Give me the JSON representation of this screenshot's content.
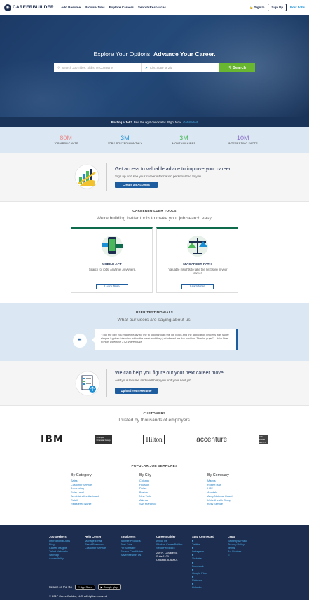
{
  "header": {
    "logo_text": "CAREERBUILDER",
    "nav": [
      "Add Resume",
      "Browse Jobs",
      "Explore Careers",
      "Search Resources"
    ],
    "sign_in": "Sign In",
    "sign_up": "Sign Up",
    "post_jobs": "Post Jobs"
  },
  "hero": {
    "title_a": "Explore Your Options.",
    "title_b": "Advance Your Career.",
    "keywords_placeholder": "Search Job Titles, Skills, or Company",
    "location_placeholder": "City, State or Zip",
    "search_button": "Search"
  },
  "post_bar": {
    "lead": "Posting a Job?",
    "text": "Find the right candidates. Right Now.",
    "link": "Get started"
  },
  "stats": [
    {
      "value": "80M",
      "label": "JOB APPLICANTS",
      "color": "#e98b8b"
    },
    {
      "value": "3M",
      "label": "JOBS POSTED MONTHLY",
      "color": "#1b8fd6"
    },
    {
      "value": "3M",
      "label": "MONTHLY HIRES",
      "color": "#4cb85c"
    },
    {
      "value": "10M",
      "label": "INTERESTING FACTS",
      "color": "#8a6ec9"
    }
  ],
  "access": {
    "title": "Get access to valuable advice to improve your career.",
    "subtitle": "Sign up and see your career information personalized to you.",
    "button": "Create an Account"
  },
  "tools": {
    "kicker": "CAREERBUILDER TOOLS",
    "subtitle": "We're building better tools to make your job search easy.",
    "cards": [
      {
        "title": "MOBILE APP",
        "text": "Search for jobs. Anytime. Anywhere.",
        "button": "Learn More"
      },
      {
        "title": "MY CAREER PATH",
        "text": "Valuable insights to take the next step in your career.",
        "button": "Learn More"
      }
    ]
  },
  "testimonials": {
    "kicker": "USER TESTIMONIALS",
    "subtitle": "What our users are saying about us.",
    "quote": "\"I got the job! You made it easy for me to look through the job posts and the application process was super simple. I got an interview within the week and they just offered me the position. Thanks guys!\"",
    "author": "- John Doe, Forklift Operator, XYZ Warehouse"
  },
  "help": {
    "title": "We can help you figure out your next career move.",
    "subtitle": "Add your resume and we'll help you find your next job.",
    "button": "Upload Your Resume"
  },
  "customers": {
    "kicker": "CUSTOMERS",
    "subtitle": "Trusted by thousands of employers.",
    "logos": [
      "IBM",
      "Principal Financial Group",
      "Hilton",
      "accenture",
      "THE HOME DEPOT"
    ]
  },
  "popular": {
    "kicker": "POPULAR JOB SEARCHES",
    "columns": [
      {
        "title": "By Category",
        "items": [
          "Sales",
          "Customer Service",
          "Accounting",
          "Entry Level",
          "Administrative Assistant",
          "Retail",
          "Registered Nurse"
        ]
      },
      {
        "title": "By City",
        "items": [
          "Chicago",
          "Houston",
          "Dallas",
          "Boston",
          "New York",
          "Atlanta",
          "San Francisco"
        ]
      },
      {
        "title": "By Company",
        "items": [
          "Macy's",
          "Robert Half",
          "UPS",
          "Aerotek",
          "Army National Guard",
          "UnitedHealth Group",
          "Kelly Service"
        ]
      }
    ]
  },
  "footer": {
    "columns": [
      {
        "title": "Job Seekers",
        "items": [
          "International Jobs",
          "Blog",
          "Career Insights",
          "Talent Networks",
          "Sitemap",
          "Accessibility"
        ]
      },
      {
        "title": "Help Center",
        "items": [
          "Manage Email",
          "Reset Password",
          "Customer Service"
        ]
      },
      {
        "title": "Employers",
        "items": [
          "Browse Products",
          "Post Jobs",
          "HR Software",
          "Source Candidates",
          "Advertise with Us"
        ]
      },
      {
        "title": "CareerBuilder",
        "items": [
          "About Us",
          "Work at CareerBuilder",
          "Send Feedback"
        ],
        "address": [
          "200 N. LaSalle St.",
          "Suite 1100",
          "Chicago, IL 60601"
        ]
      },
      {
        "title": "Stay Connected",
        "items": [
          "Twitter",
          "Instagram",
          "Youtube",
          "Facebook",
          "Google Plus",
          "Pinterest",
          "LinkedIn"
        ]
      },
      {
        "title": "Legal",
        "items": [
          "Security & Fraud",
          "Privacy Policy",
          "Terms",
          "Ad Choices"
        ]
      }
    ],
    "search_on_the_go": "Search on the Go",
    "app_store": "App Store",
    "google_play": "Google play",
    "copyright": "© 2017 CareerBuilder, LLC. All rights reserved."
  }
}
